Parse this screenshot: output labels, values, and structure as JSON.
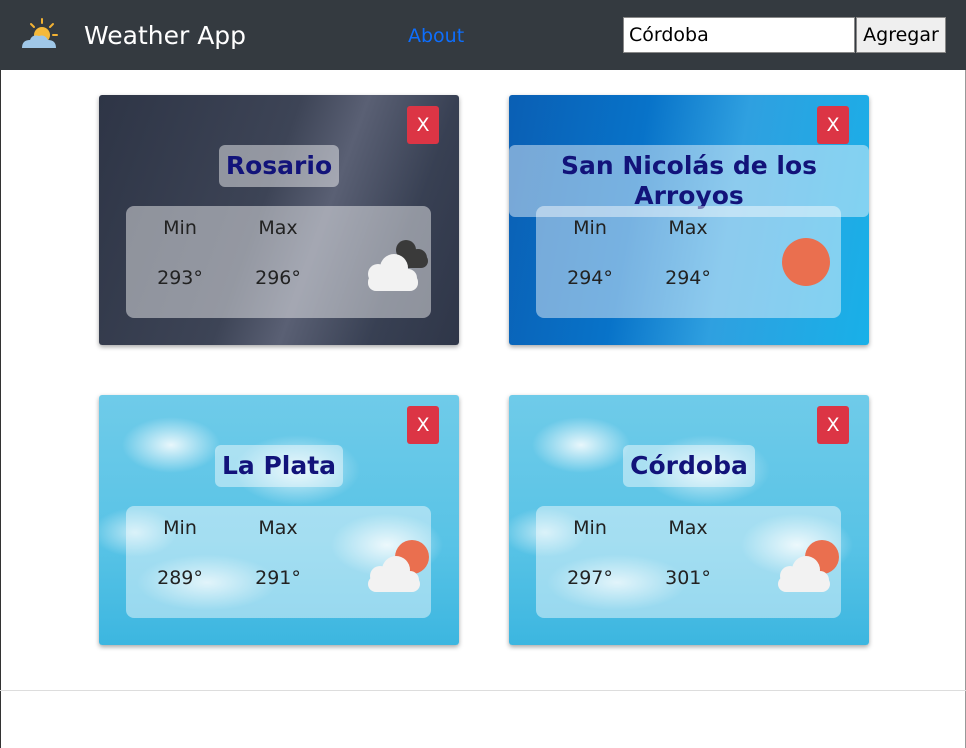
{
  "app": {
    "title": "Weather App"
  },
  "nav": {
    "about_label": "About"
  },
  "search": {
    "value": "Córdoba",
    "button_label": "Agregar"
  },
  "labels": {
    "min": "Min",
    "max": "Max",
    "close": "X"
  },
  "cards": [
    {
      "city": "Rosario",
      "min": "293°",
      "max": "296°",
      "icon": "dark-clouds-icon",
      "background": "night-clouds"
    },
    {
      "city": "San Nicolás de los Arroyos",
      "min": "294°",
      "max": "294°",
      "icon": "sun-icon",
      "background": "clear-blue"
    },
    {
      "city": "La Plata",
      "min": "289°",
      "max": "291°",
      "icon": "sun-behind-cloud-icon",
      "background": "sky-clouds"
    },
    {
      "city": "Córdoba",
      "min": "297°",
      "max": "301°",
      "icon": "sun-behind-cloud-icon",
      "background": "sky-clouds"
    }
  ],
  "colors": {
    "navbar": "#343a40",
    "link": "#0d6efd",
    "close_button": "#dc3545",
    "city_text": "#12137a"
  }
}
